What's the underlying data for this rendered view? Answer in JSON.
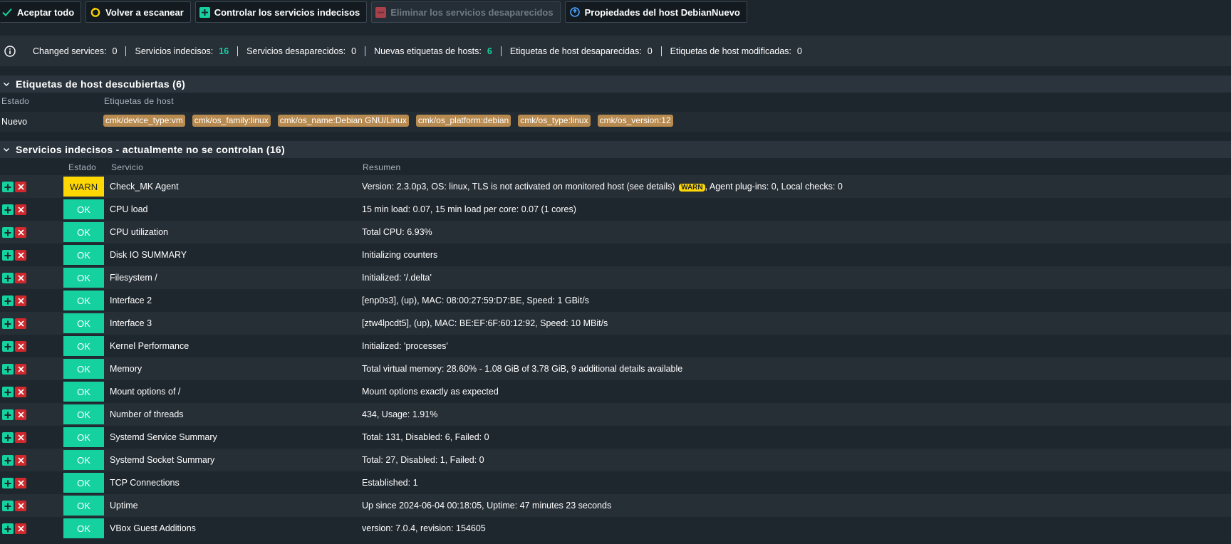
{
  "toolbar": {
    "accept_all": "Aceptar todo",
    "rescan": "Volver a escanear",
    "monitor_undecided": "Controlar los servicios indecisos",
    "remove_vanished": "Eliminar los servicios desaparecidos",
    "host_properties": "Propiedades del host DebianNuevo"
  },
  "summary": {
    "items": [
      {
        "label": "Changed services:",
        "value": "0"
      },
      {
        "label": "Servicios indecisos:",
        "value": "16"
      },
      {
        "label": "Servicios desaparecidos:",
        "value": "0"
      },
      {
        "label": "Nuevas etiquetas de hosts:",
        "value": "6"
      },
      {
        "label": "Etiquetas de host desaparecidas:",
        "value": "0"
      },
      {
        "label": "Etiquetas de host modificadas:",
        "value": "0"
      }
    ]
  },
  "host_labels": {
    "title": "Etiquetas de host descubiertas (6)",
    "col_state": "Estado",
    "col_labels": "Etiquetas de host",
    "state": "Nuevo",
    "tags": [
      "cmk/device_type:vm",
      "cmk/os_family:linux",
      "cmk/os_name:Debian GNU/Linux",
      "cmk/os_platform:debian",
      "cmk/os_type:linux",
      "cmk/os_version:12"
    ]
  },
  "services": {
    "title": "Servicios indecisos - actualmente no se controlan (16)",
    "col_state": "Estado",
    "col_service": "Servicio",
    "col_summary": "Resumen",
    "rows": [
      {
        "state": "WARN",
        "name": "Check_MK Agent",
        "summary_pre": "Version: 2.3.0p3, OS: linux, TLS is not activated on monitored host (see details)",
        "inline_badge": "WARN",
        "summary_post": ", Agent plug-ins: 0, Local checks: 0"
      },
      {
        "state": "OK",
        "name": "CPU load",
        "summary": "15 min load: 0.07, 15 min load per core: 0.07 (1 cores)"
      },
      {
        "state": "OK",
        "name": "CPU utilization",
        "summary": "Total CPU: 6.93%"
      },
      {
        "state": "OK",
        "name": "Disk IO SUMMARY",
        "summary": "Initializing counters"
      },
      {
        "state": "OK",
        "name": "Filesystem /",
        "summary": "Initialized: '/.delta'"
      },
      {
        "state": "OK",
        "name": "Interface 2",
        "summary": "[enp0s3], (up), MAC: 08:00:27:59:D7:BE, Speed: 1 GBit/s"
      },
      {
        "state": "OK",
        "name": "Interface 3",
        "summary": "[ztw4lpcdt5], (up), MAC: BE:EF:6F:60:12:92, Speed: 10 MBit/s"
      },
      {
        "state": "OK",
        "name": "Kernel Performance",
        "summary": "Initialized: 'processes'"
      },
      {
        "state": "OK",
        "name": "Memory",
        "summary": "Total virtual memory: 28.60% - 1.08 GiB of 3.78 GiB, 9 additional details available"
      },
      {
        "state": "OK",
        "name": "Mount options of /",
        "summary": "Mount options exactly as expected"
      },
      {
        "state": "OK",
        "name": "Number of threads",
        "summary": "434, Usage: 1.91%"
      },
      {
        "state": "OK",
        "name": "Systemd Service Summary",
        "summary": "Total: 131, Disabled: 6, Failed: 0"
      },
      {
        "state": "OK",
        "name": "Systemd Socket Summary",
        "summary": "Total: 27, Disabled: 1, Failed: 0"
      },
      {
        "state": "OK",
        "name": "TCP Connections",
        "summary": "Established: 1"
      },
      {
        "state": "OK",
        "name": "Uptime",
        "summary": "Up since 2024-06-04 00:18:05, Uptime: 47 minutes 23 seconds"
      },
      {
        "state": "OK",
        "name": "VBox Guest Additions",
        "summary": "version: 7.0.4, revision: 154605"
      }
    ]
  },
  "colors": {
    "ok": "#15d1a0",
    "warn": "#ffd703",
    "delete": "#d0292d",
    "tag": "#b78a50",
    "background": "#1d252d"
  }
}
